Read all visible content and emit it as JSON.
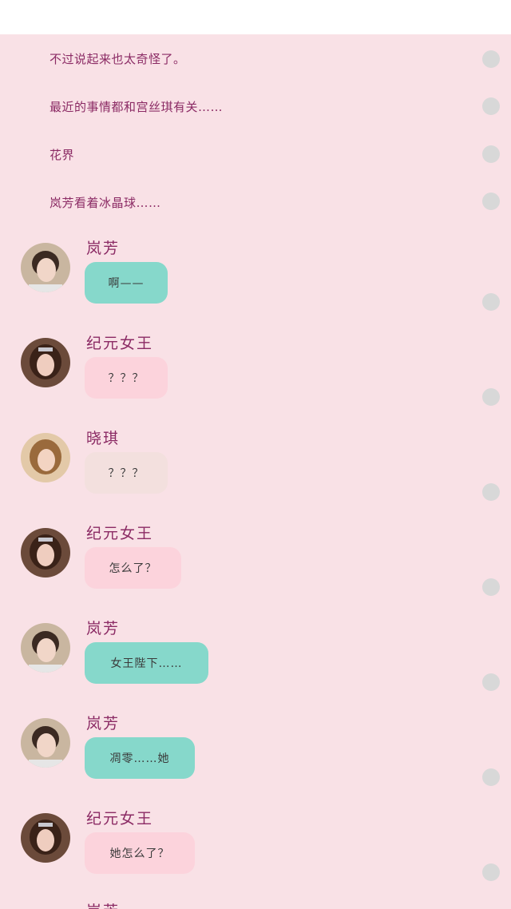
{
  "narration": [
    "不过说起来也太奇怪了。",
    "最近的事情都和宫丝琪有关……",
    "花界",
    "岚芳看着冰晶球……"
  ],
  "messages": [
    {
      "speaker": "岚芳",
      "text": "啊——",
      "bubble_color": "#86d8cb",
      "avatar": "lanfang-avatar"
    },
    {
      "speaker": "纪元女王",
      "text": "？？？",
      "bubble_color": "#fcd3dc",
      "avatar": "queen-avatar"
    },
    {
      "speaker": "晓琪",
      "text": "？？？",
      "bubble_color": "#f3e0de",
      "avatar": "xiaoqi-avatar"
    },
    {
      "speaker": "纪元女王",
      "text": "怎么了？",
      "bubble_color": "#fcd3dc",
      "avatar": "queen-avatar"
    },
    {
      "speaker": "岚芳",
      "text": "女王陛下……",
      "bubble_color": "#86d8cb",
      "avatar": "lanfang-avatar"
    },
    {
      "speaker": "岚芳",
      "text": "凋零……她",
      "bubble_color": "#86d8cb",
      "avatar": "lanfang-avatar"
    },
    {
      "speaker": "纪元女王",
      "text": "她怎么了？",
      "bubble_color": "#fcd3dc",
      "avatar": "queen-avatar"
    },
    {
      "speaker": "岚芳",
      "text": "",
      "bubble_color": "#86d8cb",
      "avatar": "lanfang-avatar"
    }
  ]
}
